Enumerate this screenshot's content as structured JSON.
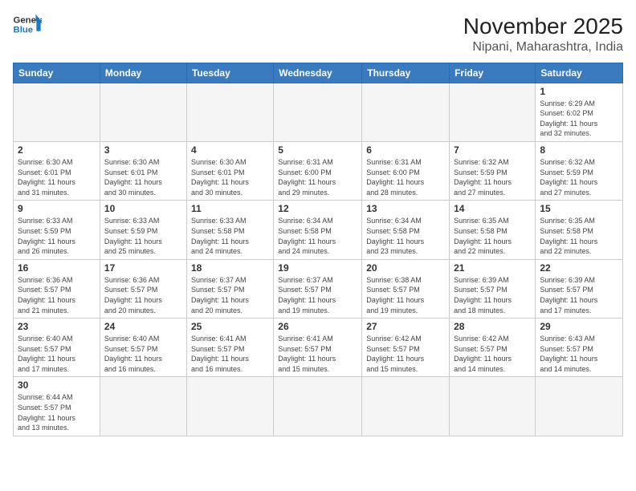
{
  "header": {
    "logo_general": "General",
    "logo_blue": "Blue",
    "title": "November 2025",
    "subtitle": "Nipani, Maharashtra, India"
  },
  "weekdays": [
    "Sunday",
    "Monday",
    "Tuesday",
    "Wednesday",
    "Thursday",
    "Friday",
    "Saturday"
  ],
  "days": [
    {
      "num": "",
      "sunrise": "",
      "sunset": "",
      "daylight": "",
      "empty": true
    },
    {
      "num": "",
      "sunrise": "",
      "sunset": "",
      "daylight": "",
      "empty": true
    },
    {
      "num": "",
      "sunrise": "",
      "sunset": "",
      "daylight": "",
      "empty": true
    },
    {
      "num": "",
      "sunrise": "",
      "sunset": "",
      "daylight": "",
      "empty": true
    },
    {
      "num": "",
      "sunrise": "",
      "sunset": "",
      "daylight": "",
      "empty": true
    },
    {
      "num": "",
      "sunrise": "",
      "sunset": "",
      "daylight": "",
      "empty": true
    },
    {
      "num": "1",
      "info": "Sunrise: 6:29 AM\nSunset: 6:02 PM\nDaylight: 11 hours\nand 32 minutes."
    },
    {
      "num": "2",
      "info": "Sunrise: 6:30 AM\nSunset: 6:01 PM\nDaylight: 11 hours\nand 31 minutes."
    },
    {
      "num": "3",
      "info": "Sunrise: 6:30 AM\nSunset: 6:01 PM\nDaylight: 11 hours\nand 30 minutes."
    },
    {
      "num": "4",
      "info": "Sunrise: 6:30 AM\nSunset: 6:01 PM\nDaylight: 11 hours\nand 30 minutes."
    },
    {
      "num": "5",
      "info": "Sunrise: 6:31 AM\nSunset: 6:00 PM\nDaylight: 11 hours\nand 29 minutes."
    },
    {
      "num": "6",
      "info": "Sunrise: 6:31 AM\nSunset: 6:00 PM\nDaylight: 11 hours\nand 28 minutes."
    },
    {
      "num": "7",
      "info": "Sunrise: 6:32 AM\nSunset: 5:59 PM\nDaylight: 11 hours\nand 27 minutes."
    },
    {
      "num": "8",
      "info": "Sunrise: 6:32 AM\nSunset: 5:59 PM\nDaylight: 11 hours\nand 27 minutes."
    },
    {
      "num": "9",
      "info": "Sunrise: 6:33 AM\nSunset: 5:59 PM\nDaylight: 11 hours\nand 26 minutes."
    },
    {
      "num": "10",
      "info": "Sunrise: 6:33 AM\nSunset: 5:59 PM\nDaylight: 11 hours\nand 25 minutes."
    },
    {
      "num": "11",
      "info": "Sunrise: 6:33 AM\nSunset: 5:58 PM\nDaylight: 11 hours\nand 24 minutes."
    },
    {
      "num": "12",
      "info": "Sunrise: 6:34 AM\nSunset: 5:58 PM\nDaylight: 11 hours\nand 24 minutes."
    },
    {
      "num": "13",
      "info": "Sunrise: 6:34 AM\nSunset: 5:58 PM\nDaylight: 11 hours\nand 23 minutes."
    },
    {
      "num": "14",
      "info": "Sunrise: 6:35 AM\nSunset: 5:58 PM\nDaylight: 11 hours\nand 22 minutes."
    },
    {
      "num": "15",
      "info": "Sunrise: 6:35 AM\nSunset: 5:58 PM\nDaylight: 11 hours\nand 22 minutes."
    },
    {
      "num": "16",
      "info": "Sunrise: 6:36 AM\nSunset: 5:57 PM\nDaylight: 11 hours\nand 21 minutes."
    },
    {
      "num": "17",
      "info": "Sunrise: 6:36 AM\nSunset: 5:57 PM\nDaylight: 11 hours\nand 20 minutes."
    },
    {
      "num": "18",
      "info": "Sunrise: 6:37 AM\nSunset: 5:57 PM\nDaylight: 11 hours\nand 20 minutes."
    },
    {
      "num": "19",
      "info": "Sunrise: 6:37 AM\nSunset: 5:57 PM\nDaylight: 11 hours\nand 19 minutes."
    },
    {
      "num": "20",
      "info": "Sunrise: 6:38 AM\nSunset: 5:57 PM\nDaylight: 11 hours\nand 19 minutes."
    },
    {
      "num": "21",
      "info": "Sunrise: 6:39 AM\nSunset: 5:57 PM\nDaylight: 11 hours\nand 18 minutes."
    },
    {
      "num": "22",
      "info": "Sunrise: 6:39 AM\nSunset: 5:57 PM\nDaylight: 11 hours\nand 17 minutes."
    },
    {
      "num": "23",
      "info": "Sunrise: 6:40 AM\nSunset: 5:57 PM\nDaylight: 11 hours\nand 17 minutes."
    },
    {
      "num": "24",
      "info": "Sunrise: 6:40 AM\nSunset: 5:57 PM\nDaylight: 11 hours\nand 16 minutes."
    },
    {
      "num": "25",
      "info": "Sunrise: 6:41 AM\nSunset: 5:57 PM\nDaylight: 11 hours\nand 16 minutes."
    },
    {
      "num": "26",
      "info": "Sunrise: 6:41 AM\nSunset: 5:57 PM\nDaylight: 11 hours\nand 15 minutes."
    },
    {
      "num": "27",
      "info": "Sunrise: 6:42 AM\nSunset: 5:57 PM\nDaylight: 11 hours\nand 15 minutes."
    },
    {
      "num": "28",
      "info": "Sunrise: 6:42 AM\nSunset: 5:57 PM\nDaylight: 11 hours\nand 14 minutes."
    },
    {
      "num": "29",
      "info": "Sunrise: 6:43 AM\nSunset: 5:57 PM\nDaylight: 11 hours\nand 14 minutes."
    },
    {
      "num": "30",
      "info": "Sunrise: 6:44 AM\nSunset: 5:57 PM\nDaylight: 11 hours\nand 13 minutes."
    },
    {
      "num": "",
      "info": "",
      "empty": true
    },
    {
      "num": "",
      "info": "",
      "empty": true
    },
    {
      "num": "",
      "info": "",
      "empty": true
    },
    {
      "num": "",
      "info": "",
      "empty": true
    },
    {
      "num": "",
      "info": "",
      "empty": true
    },
    {
      "num": "",
      "info": "",
      "empty": true
    }
  ]
}
